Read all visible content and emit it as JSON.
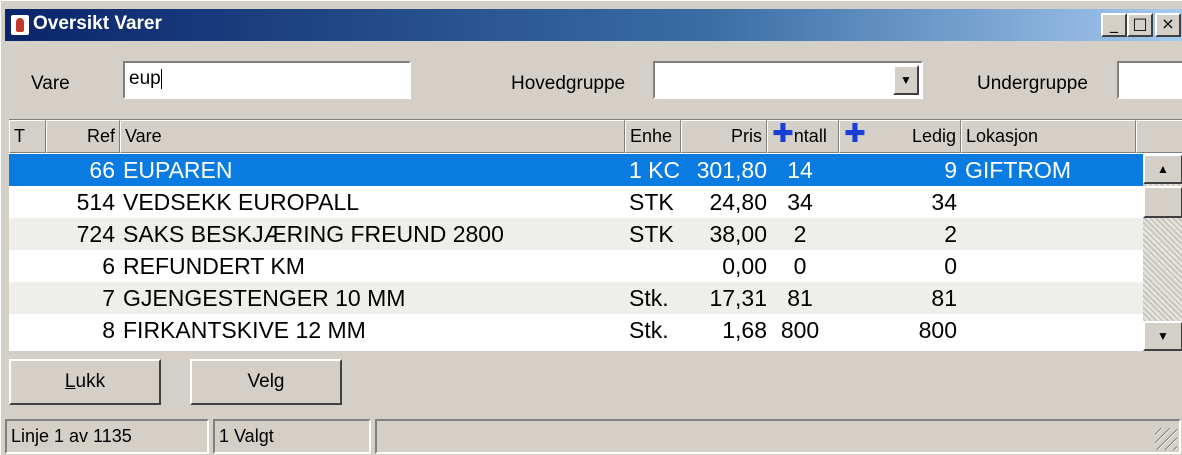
{
  "window": {
    "title": "Oversikt Varer",
    "min_glyph": "_",
    "max_glyph": "□",
    "close_glyph": "×"
  },
  "filters": {
    "vare_label": "Vare",
    "vare_value": "eup",
    "hovedgruppe_label": "Hovedgruppe",
    "hovedgruppe_value": "",
    "undergruppe_label": "Undergruppe",
    "undergruppe_value": ""
  },
  "grid": {
    "columns": [
      "T",
      "Ref",
      "Vare",
      "Enhe",
      "Pris",
      "ntall",
      "Ledig",
      "Lokasjon"
    ],
    "plus_glyph": "✚",
    "rows": [
      {
        "ref": "66",
        "vare": "EUPAREN",
        "enhet": "1 KC",
        "pris": "301,80",
        "antall": "14",
        "ledig": "9",
        "lokasjon": "GIFTROM"
      },
      {
        "ref": "514",
        "vare": "VEDSEKK EUROPALL",
        "enhet": "STK",
        "pris": "24,80",
        "antall": "34",
        "ledig": "34",
        "lokasjon": ""
      },
      {
        "ref": "724",
        "vare": "SAKS BESKJÆRING FREUND 2800",
        "enhet": "STK",
        "pris": "38,00",
        "antall": "2",
        "ledig": "2",
        "lokasjon": ""
      },
      {
        "ref": "6",
        "vare": "REFUNDERT KM",
        "enhet": "",
        "pris": "0,00",
        "antall": "0",
        "ledig": "0",
        "lokasjon": ""
      },
      {
        "ref": "7",
        "vare": "GJENGESTENGER 10 MM",
        "enhet": "Stk.",
        "pris": "17,31",
        "antall": "81",
        "ledig": "81",
        "lokasjon": ""
      },
      {
        "ref": "8",
        "vare": "FIRKANTSKIVE 12 MM",
        "enhet": "Stk.",
        "pris": "1,68",
        "antall": "800",
        "ledig": "800",
        "lokasjon": ""
      }
    ]
  },
  "buttons": {
    "lukk_underlined": "L",
    "lukk_rest": "ukk",
    "velg": "Velg"
  },
  "status": {
    "linje": "Linje 1 av 1135",
    "valgt": "1 Valgt"
  },
  "colors": {
    "selection": "#0a7be0",
    "title_start": "#0a246a",
    "plus": "#1a3fd6"
  }
}
